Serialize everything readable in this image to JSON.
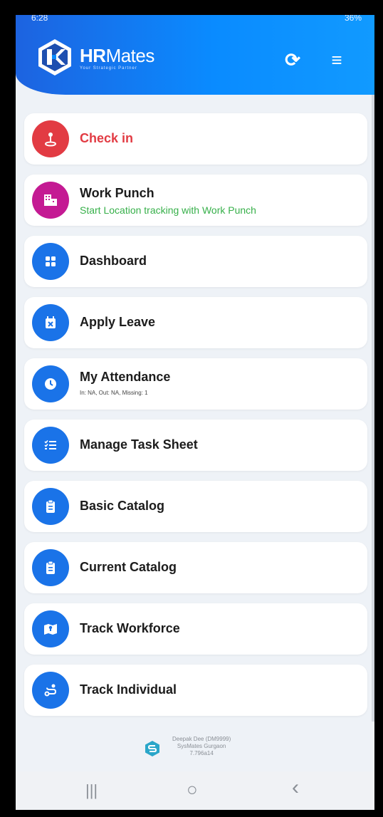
{
  "status": {
    "time": "6:28",
    "right": "36%"
  },
  "header": {
    "brand_bold": "HR",
    "brand_rest": "Mates",
    "tagline": "Your Strategic Partner"
  },
  "colors": {
    "header": "#0a8bff",
    "checkin_red": "#e23b43",
    "workpunch_magenta": "#c41a93",
    "blue": "#1a73e8",
    "green": "#37b04a"
  },
  "items": [
    {
      "label": "Check in",
      "icon": "person-pin-icon"
    },
    {
      "label": "Work Punch",
      "sub": "Start Location tracking with Work Punch",
      "icon": "building-icon"
    },
    {
      "label": "Dashboard",
      "icon": "grid-icon"
    },
    {
      "label": "Apply Leave",
      "icon": "calendar-icon"
    },
    {
      "label": "My Attendance",
      "sub": "In: NA, Out: NA, Missing: 1",
      "icon": "clock-icon"
    },
    {
      "label": "Manage Task Sheet",
      "icon": "checklist-icon"
    },
    {
      "label": "Basic Catalog",
      "icon": "clipboard-icon"
    },
    {
      "label": "Current Catalog",
      "icon": "clipboard-icon"
    },
    {
      "label": "Track Workforce",
      "icon": "map-icon"
    },
    {
      "label": "Track Individual",
      "icon": "route-icon"
    }
  ],
  "footer": {
    "line1": "Deepak Dee (DM9999)",
    "line2": "SysMates Gurgaon",
    "line3": "7.796a14"
  },
  "nav": {
    "recents": "|||",
    "home": "○",
    "back": "‹"
  }
}
